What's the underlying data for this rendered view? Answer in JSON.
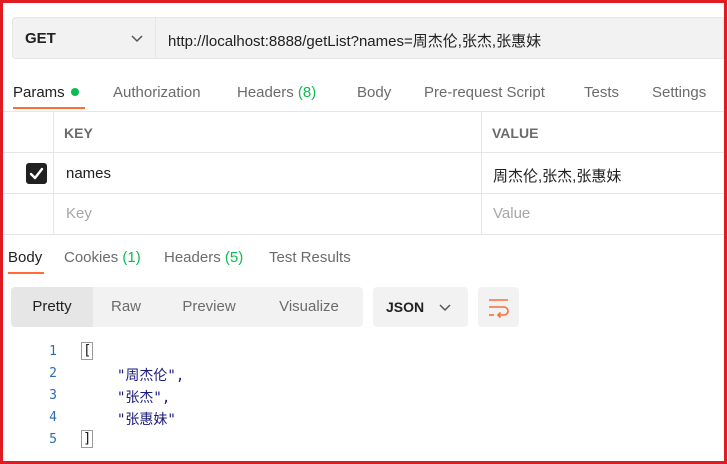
{
  "request": {
    "method": "GET",
    "url": "http://localhost:8888/getList?names=周杰伦,张杰,张惠妹"
  },
  "request_tabs": [
    {
      "label": "Params",
      "active": true,
      "has_dot": true
    },
    {
      "label": "Authorization"
    },
    {
      "label": "Headers",
      "count": "(8)"
    },
    {
      "label": "Body"
    },
    {
      "label": "Pre-request Script"
    },
    {
      "label": "Tests"
    },
    {
      "label": "Settings"
    }
  ],
  "params_table": {
    "headers": {
      "key": "KEY",
      "value": "VALUE"
    },
    "rows": [
      {
        "checked": true,
        "key": "names",
        "value": "周杰伦,张杰,张惠妹"
      }
    ],
    "placeholder": {
      "key": "Key",
      "value": "Value"
    }
  },
  "response_tabs": [
    {
      "label": "Body",
      "active": true
    },
    {
      "label": "Cookies",
      "count": "(1)"
    },
    {
      "label": "Headers",
      "count": "(5)"
    },
    {
      "label": "Test Results"
    }
  ],
  "view_modes": [
    "Pretty",
    "Raw",
    "Preview",
    "Visualize"
  ],
  "format": "JSON",
  "code": {
    "line_numbers": [
      "1",
      "2",
      "3",
      "4",
      "5"
    ],
    "lines": [
      "[",
      "\"周杰伦\",",
      "\"张杰\",",
      "\"张惠妹\"",
      "]"
    ]
  },
  "colors": {
    "border": "#e11b22",
    "accent": "#ff6c37",
    "green": "#0cbb52"
  }
}
